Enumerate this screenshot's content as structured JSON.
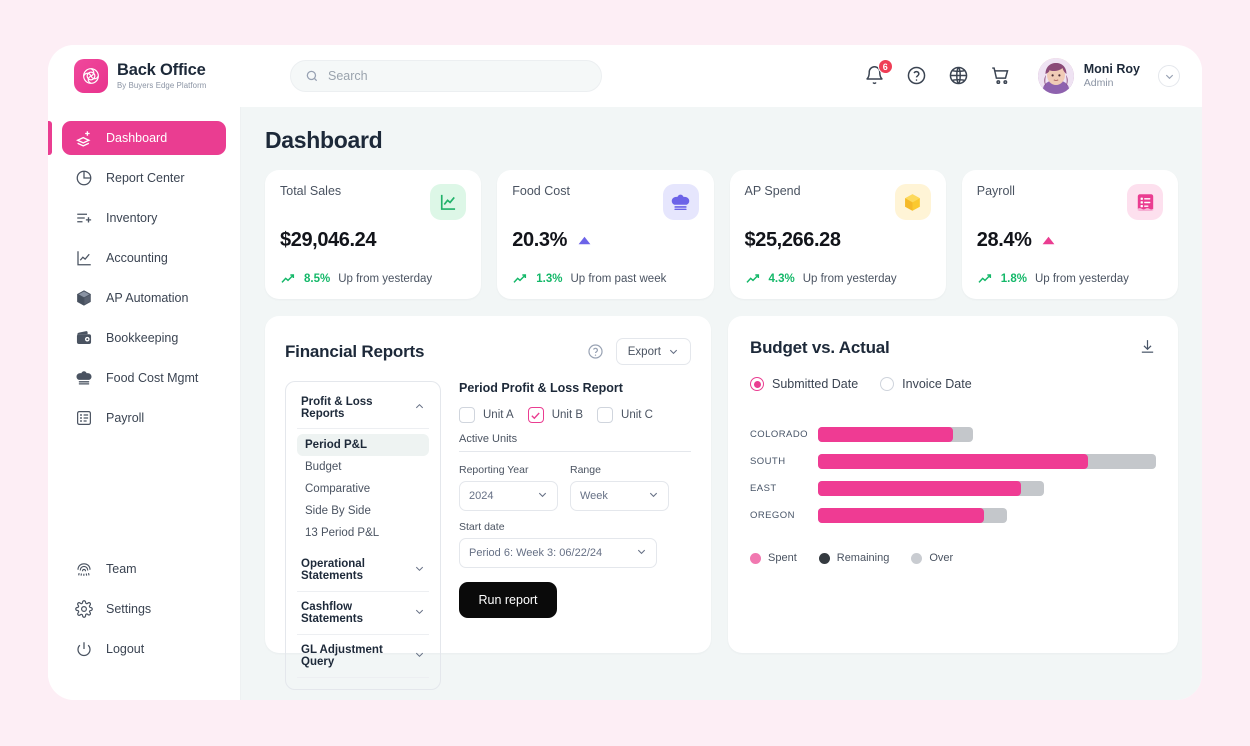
{
  "brand": {
    "name": "Back Office",
    "tagline": "By Buyers Edge Platform",
    "logo_icon": "swirl-logo-icon",
    "color": "#ea3d91"
  },
  "search": {
    "placeholder": "Search",
    "icon": "search-icon"
  },
  "topbar": {
    "icons": [
      {
        "name": "notification-bell-icon",
        "badge": "6"
      },
      {
        "name": "help-circle-icon",
        "badge": ""
      },
      {
        "name": "globe-icon",
        "badge": ""
      },
      {
        "name": "cart-icon",
        "badge": ""
      }
    ],
    "user": {
      "name": "Moni Roy",
      "role": "Admin",
      "avatar": "user-avatar",
      "caret": "chevron-down-icon"
    }
  },
  "sidebar": {
    "items": [
      {
        "label": "Dashboard",
        "icon": "layers-plus-icon",
        "active": true
      },
      {
        "label": "Report Center",
        "icon": "pie-chart-icon",
        "active": false
      },
      {
        "label": "Inventory",
        "icon": "list-plus-icon",
        "active": false
      },
      {
        "label": "Accounting",
        "icon": "line-chart-icon",
        "active": false
      },
      {
        "label": "AP Automation",
        "icon": "box-icon",
        "active": false
      },
      {
        "label": "Bookkeeping",
        "icon": "wallet-icon",
        "active": false
      },
      {
        "label": "Food Cost Mgmt",
        "icon": "chef-hat-icon",
        "active": false
      },
      {
        "label": "Payroll",
        "icon": "payroll-doc-icon",
        "active": false
      }
    ],
    "bottom_items": [
      {
        "label": "Team",
        "icon": "fingerprint-icon"
      },
      {
        "label": "Settings",
        "icon": "gear-icon"
      },
      {
        "label": "Logout",
        "icon": "power-icon"
      }
    ]
  },
  "main": {
    "title": "Dashboard",
    "kpis": [
      {
        "label": "Total Sales",
        "value": "$29,046.24",
        "pct": "8.5%",
        "delta_text": "Up from yesterday",
        "icon": "line-chart-icon",
        "icon_bg": "#ddf7e7",
        "icon_color": "#21b26a",
        "trend_arrow": ""
      },
      {
        "label": "Food Cost",
        "value": "20.3%",
        "pct": "1.3%",
        "delta_text": "Up from past week",
        "icon": "chef-hat-icon",
        "icon_bg": "#e6e6fd",
        "icon_color": "#6c63e8",
        "trend_arrow": "up-triangle-indigo"
      },
      {
        "label": "AP Spend",
        "value": "$25,266.28",
        "pct": "4.3%",
        "delta_text": "Up from yesterday",
        "icon": "box-icon",
        "icon_bg": "#fff4d6",
        "icon_color": "#f5b929",
        "trend_arrow": ""
      },
      {
        "label": "Payroll",
        "value": "28.4%",
        "pct": "1.8%",
        "delta_text": "Up from yesterday",
        "icon": "payroll-doc-icon",
        "icon_bg": "#fde0ee",
        "icon_color": "#ea3d91",
        "trend_arrow": "up-triangle-pink"
      }
    ]
  },
  "financial_reports": {
    "title": "Financial Reports",
    "help_icon": "help-circle-icon",
    "export_label": "Export",
    "export_caret": "chevron-down-icon",
    "groups": [
      {
        "label": "Profit & Loss Reports",
        "expanded": true,
        "chevron": "chevron-up-icon",
        "items": [
          {
            "label": "Period P&L",
            "selected": true
          },
          {
            "label": "Budget",
            "selected": false
          },
          {
            "label": "Comparative",
            "selected": false
          },
          {
            "label": "Side By Side",
            "selected": false
          },
          {
            "label": "13 Period P&L",
            "selected": false
          }
        ]
      },
      {
        "label": "Operational Statements",
        "expanded": false,
        "chevron": "chevron-down-icon",
        "items": []
      },
      {
        "label": "Cashflow Statements",
        "expanded": false,
        "chevron": "chevron-down-icon",
        "items": []
      },
      {
        "label": "GL Adjustment Query",
        "expanded": false,
        "chevron": "chevron-down-icon",
        "items": []
      }
    ],
    "form": {
      "title": "Period Profit & Loss Report",
      "units": [
        {
          "label": "Unit A",
          "checked": false
        },
        {
          "label": "Unit B",
          "checked": true
        },
        {
          "label": "Unit C",
          "checked": false
        }
      ],
      "active_units_label": "Active Units",
      "reporting_year_label": "Reporting Year",
      "reporting_year_value": "2024",
      "range_label": "Range",
      "range_value": "Week",
      "start_date_label": "Start date",
      "start_date_value": "Period 6: Week 3: 06/22/24",
      "run_label": "Run report"
    }
  },
  "budget_vs_actual": {
    "title": "Budget vs. Actual",
    "download_icon": "download-icon",
    "date_options": [
      {
        "label": "Submitted Date",
        "selected": true
      },
      {
        "label": "Invoice Date",
        "selected": false
      }
    ],
    "legend": [
      {
        "label": "Spent",
        "color": "#ef3b93"
      },
      {
        "label": "Remaining",
        "color": "#343a40"
      },
      {
        "label": "Over",
        "color": "#c9ccd1"
      }
    ]
  },
  "chart_data": {
    "type": "bar",
    "orientation": "horizontal",
    "title": "Budget vs. Actual",
    "categories": [
      "COLORADO",
      "SOUTH",
      "EAST",
      "OREGON"
    ],
    "series": [
      {
        "name": "Spent",
        "color": "#ef3b93",
        "values": [
          40,
          80,
          60,
          49
        ]
      },
      {
        "name": "Over",
        "color": "#c4c7cb",
        "values": [
          46,
          100,
          67,
          56
        ]
      }
    ],
    "xlim": [
      0,
      100
    ],
    "xlabel": "",
    "ylabel": "",
    "grid": false,
    "legend_position": "bottom-left",
    "note": "Values are percent of full track width; Over bar is drawn behind and extends past Spent bar."
  }
}
